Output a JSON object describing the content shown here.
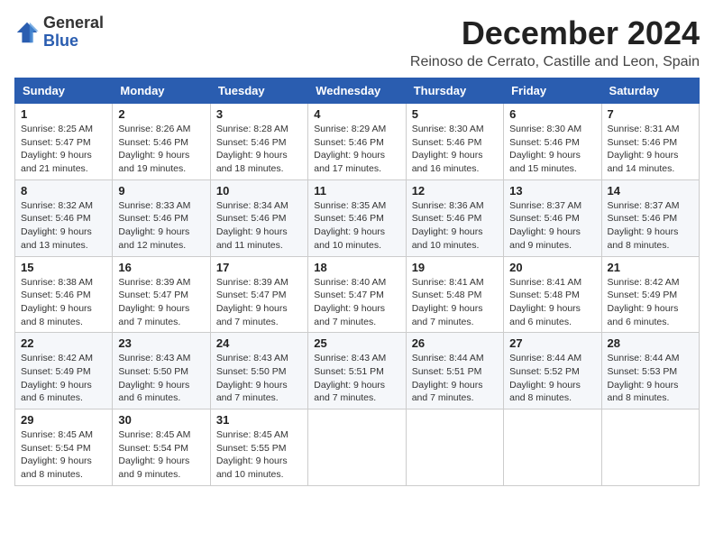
{
  "logo": {
    "general": "General",
    "blue": "Blue"
  },
  "title": "December 2024",
  "subtitle": "Reinoso de Cerrato, Castille and Leon, Spain",
  "headers": [
    "Sunday",
    "Monday",
    "Tuesday",
    "Wednesday",
    "Thursday",
    "Friday",
    "Saturday"
  ],
  "weeks": [
    [
      {
        "day": "1",
        "sunrise": "8:25 AM",
        "sunset": "5:47 PM",
        "daylight": "9 hours and 21 minutes."
      },
      {
        "day": "2",
        "sunrise": "8:26 AM",
        "sunset": "5:46 PM",
        "daylight": "9 hours and 19 minutes."
      },
      {
        "day": "3",
        "sunrise": "8:28 AM",
        "sunset": "5:46 PM",
        "daylight": "9 hours and 18 minutes."
      },
      {
        "day": "4",
        "sunrise": "8:29 AM",
        "sunset": "5:46 PM",
        "daylight": "9 hours and 17 minutes."
      },
      {
        "day": "5",
        "sunrise": "8:30 AM",
        "sunset": "5:46 PM",
        "daylight": "9 hours and 16 minutes."
      },
      {
        "day": "6",
        "sunrise": "8:30 AM",
        "sunset": "5:46 PM",
        "daylight": "9 hours and 15 minutes."
      },
      {
        "day": "7",
        "sunrise": "8:31 AM",
        "sunset": "5:46 PM",
        "daylight": "9 hours and 14 minutes."
      }
    ],
    [
      {
        "day": "8",
        "sunrise": "8:32 AM",
        "sunset": "5:46 PM",
        "daylight": "9 hours and 13 minutes."
      },
      {
        "day": "9",
        "sunrise": "8:33 AM",
        "sunset": "5:46 PM",
        "daylight": "9 hours and 12 minutes."
      },
      {
        "day": "10",
        "sunrise": "8:34 AM",
        "sunset": "5:46 PM",
        "daylight": "9 hours and 11 minutes."
      },
      {
        "day": "11",
        "sunrise": "8:35 AM",
        "sunset": "5:46 PM",
        "daylight": "9 hours and 10 minutes."
      },
      {
        "day": "12",
        "sunrise": "8:36 AM",
        "sunset": "5:46 PM",
        "daylight": "9 hours and 10 minutes."
      },
      {
        "day": "13",
        "sunrise": "8:37 AM",
        "sunset": "5:46 PM",
        "daylight": "9 hours and 9 minutes."
      },
      {
        "day": "14",
        "sunrise": "8:37 AM",
        "sunset": "5:46 PM",
        "daylight": "9 hours and 8 minutes."
      }
    ],
    [
      {
        "day": "15",
        "sunrise": "8:38 AM",
        "sunset": "5:46 PM",
        "daylight": "9 hours and 8 minutes."
      },
      {
        "day": "16",
        "sunrise": "8:39 AM",
        "sunset": "5:47 PM",
        "daylight": "9 hours and 7 minutes."
      },
      {
        "day": "17",
        "sunrise": "8:39 AM",
        "sunset": "5:47 PM",
        "daylight": "9 hours and 7 minutes."
      },
      {
        "day": "18",
        "sunrise": "8:40 AM",
        "sunset": "5:47 PM",
        "daylight": "9 hours and 7 minutes."
      },
      {
        "day": "19",
        "sunrise": "8:41 AM",
        "sunset": "5:48 PM",
        "daylight": "9 hours and 7 minutes."
      },
      {
        "day": "20",
        "sunrise": "8:41 AM",
        "sunset": "5:48 PM",
        "daylight": "9 hours and 6 minutes."
      },
      {
        "day": "21",
        "sunrise": "8:42 AM",
        "sunset": "5:49 PM",
        "daylight": "9 hours and 6 minutes."
      }
    ],
    [
      {
        "day": "22",
        "sunrise": "8:42 AM",
        "sunset": "5:49 PM",
        "daylight": "9 hours and 6 minutes."
      },
      {
        "day": "23",
        "sunrise": "8:43 AM",
        "sunset": "5:50 PM",
        "daylight": "9 hours and 6 minutes."
      },
      {
        "day": "24",
        "sunrise": "8:43 AM",
        "sunset": "5:50 PM",
        "daylight": "9 hours and 7 minutes."
      },
      {
        "day": "25",
        "sunrise": "8:43 AM",
        "sunset": "5:51 PM",
        "daylight": "9 hours and 7 minutes."
      },
      {
        "day": "26",
        "sunrise": "8:44 AM",
        "sunset": "5:51 PM",
        "daylight": "9 hours and 7 minutes."
      },
      {
        "day": "27",
        "sunrise": "8:44 AM",
        "sunset": "5:52 PM",
        "daylight": "9 hours and 8 minutes."
      },
      {
        "day": "28",
        "sunrise": "8:44 AM",
        "sunset": "5:53 PM",
        "daylight": "9 hours and 8 minutes."
      }
    ],
    [
      {
        "day": "29",
        "sunrise": "8:45 AM",
        "sunset": "5:54 PM",
        "daylight": "9 hours and 8 minutes."
      },
      {
        "day": "30",
        "sunrise": "8:45 AM",
        "sunset": "5:54 PM",
        "daylight": "9 hours and 9 minutes."
      },
      {
        "day": "31",
        "sunrise": "8:45 AM",
        "sunset": "5:55 PM",
        "daylight": "9 hours and 10 minutes."
      },
      null,
      null,
      null,
      null
    ]
  ]
}
